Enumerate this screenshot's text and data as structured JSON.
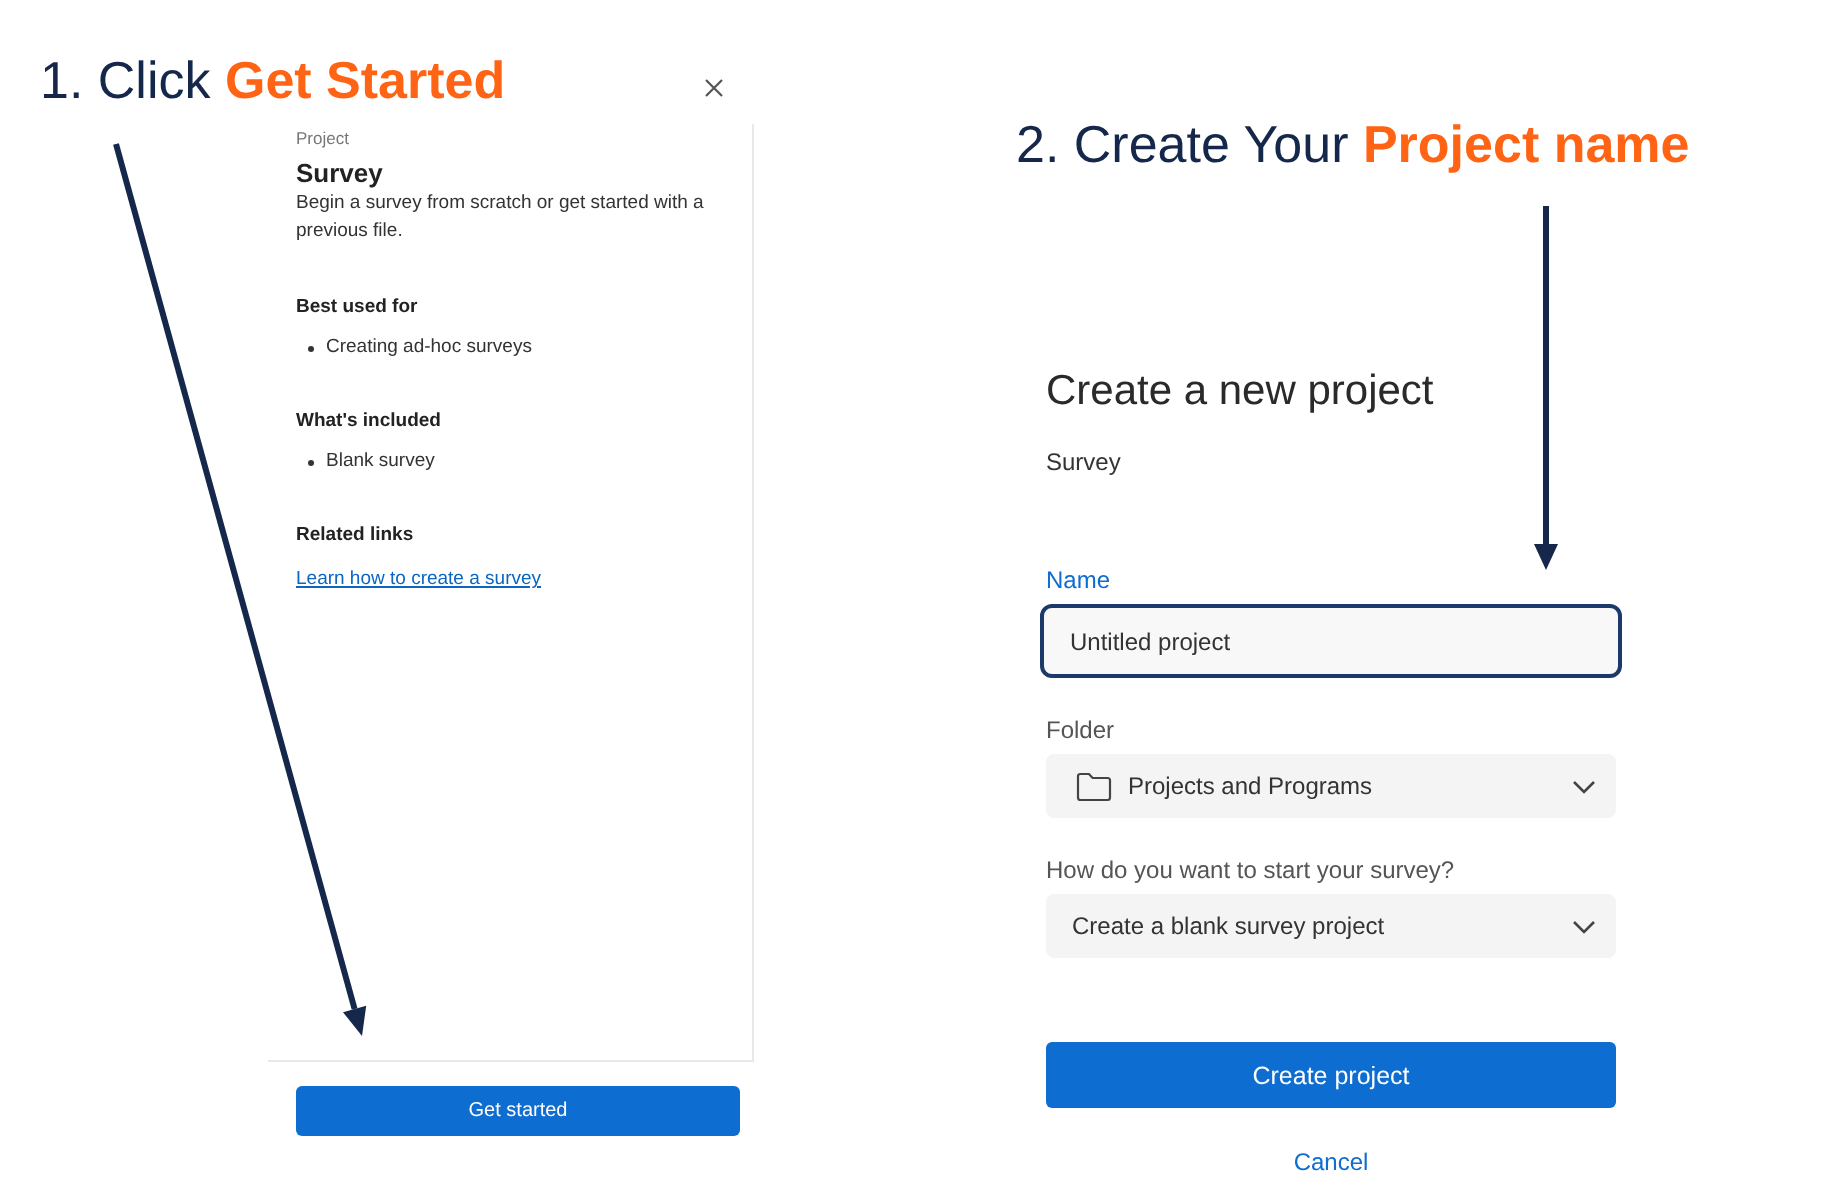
{
  "step_1": {
    "heading": "1. Click **Get Started**"
  },
  "project_panel": {
    "category": "Project",
    "title": "Survey",
    "description": "Begin a survey from scratch or get started with a previous file.",
    "sections": [
      {
        "kind": "list",
        "heading": "Best used for",
        "items": [
          "Creating ad-hoc surveys"
        ]
      },
      {
        "kind": "list",
        "heading": "What's included",
        "items": [
          "Blank survey"
        ]
      },
      {
        "kind": "links",
        "heading": "Related links",
        "items": [
          "Learn how to create a survey"
        ]
      }
    ],
    "button": "Get started"
  },
  "step_2": {
    "heading": "2. Create Your **Project name**"
  },
  "new_project_form": {
    "title": "Create a new project",
    "subtitle": "Survey",
    "fields": [
      {
        "kind": "text",
        "label": "Name",
        "value": "Untitled project",
        "focused": true
      },
      {
        "kind": "folder_select",
        "label": "Folder",
        "value": "Projects and Programs",
        "focused": false
      },
      {
        "kind": "select",
        "label": "How do you want to start your survey?",
        "value": "Create a blank survey project",
        "focused": false
      }
    ],
    "submit_button": "Create project",
    "cancel_link": "Cancel"
  }
}
